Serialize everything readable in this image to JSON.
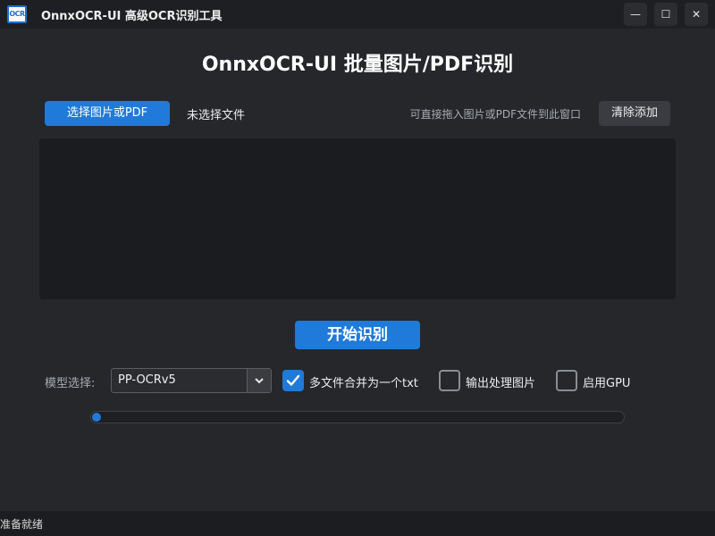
{
  "window": {
    "icon_text": "OCR",
    "title": "OnnxOCR-UI 高级OCR识别工具",
    "minimize_glyph": "—",
    "maximize_glyph": "☐",
    "close_glyph": "✕"
  },
  "main": {
    "title": "OnnxOCR-UI 批量图片/PDF识别",
    "select_button": "选择图片或PDF",
    "file_status": "未选择文件",
    "drop_hint": "可直接拖入图片或PDF文件到此窗口",
    "clear_button": "清除添加",
    "start_button": "开始识别"
  },
  "options": {
    "model_label": "模型选择:",
    "model_value": "PP-OCRv5",
    "merge_txt": {
      "label": "多文件合并为一个txt",
      "checked": true
    },
    "output_images": {
      "label": "输出处理图片",
      "checked": false
    },
    "use_gpu": {
      "label": "启用GPU",
      "checked": false
    }
  },
  "progress": {
    "value_percent": 0
  },
  "status": {
    "text": "准备就绪"
  },
  "colors": {
    "accent": "#1f7ad9",
    "background": "#25272b",
    "panel": "#1b1c1f"
  },
  "icons": {
    "app": "ocr-app-icon",
    "minimize": "minimize-icon",
    "maximize": "maximize-icon",
    "close": "close-icon",
    "dropdown": "chevron-down-icon",
    "check": "checkmark-icon"
  }
}
